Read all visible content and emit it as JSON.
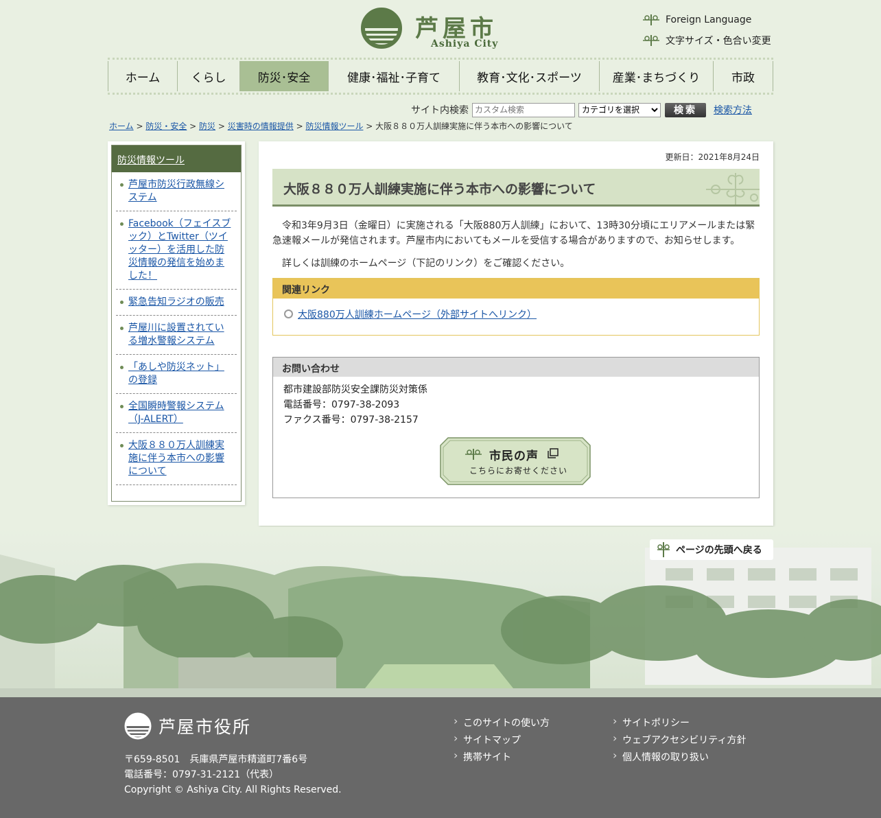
{
  "header": {
    "city_name": "芦屋市",
    "city_name_en": "Ashiya City",
    "util_links": [
      "Foreign Language",
      "文字サイズ・色合い変更"
    ]
  },
  "nav": {
    "items": [
      "ホーム",
      "くらし",
      "防災･安全",
      "健康･福祉･子育て",
      "教育･文化･スポーツ",
      "産業･まちづくり",
      "市政"
    ],
    "active_index": 2
  },
  "search": {
    "label": "サイト内検索",
    "placeholder": "カスタム検索",
    "category_selected": "カテゴリを選択",
    "button": "検索",
    "how_link": "検索方法"
  },
  "breadcrumb": {
    "links": [
      "ホーム",
      "防災・安全",
      "防災",
      "災害時の情報提供",
      "防災情報ツール"
    ],
    "current": "大阪８８０万人訓練実施に伴う本市への影響について",
    "sep": " > "
  },
  "sidebar": {
    "heading": "防災情報ツール",
    "items": [
      "芦屋市防災行政無線システム",
      "Facebook（フェイスブック）とTwitter（ツイッター）を活用した防災情報の発信を始めました！",
      "緊急告知ラジオの販売",
      "芦屋川に設置されている増水警報システム",
      "「あしや防災ネット」の登録",
      "全国瞬時警報システム（J-ALERT）",
      "大阪８８０万人訓練実施に伴う本市への影響について"
    ]
  },
  "main": {
    "updated": "更新日：2021年8月24日",
    "title": "大阪８８０万人訓練実施に伴う本市への影響について",
    "para1": "令和3年9月3日（金曜日）に実施される「大阪880万人訓練」において、13時30分頃にエリアメールまたは緊急速報メールが発信されます。芦屋市内においてもメールを受信する場合がありますので、お知らせします。",
    "para2": "詳しくは訓練のホームページ（下記のリンク）をご確認ください。",
    "related_heading": "関連リンク",
    "related_link": "大阪880万人訓練ホームページ（外部サイトへリンク）",
    "contact_heading": "お問い合わせ",
    "contact_lines": [
      "都市建設部防災安全課防災対策係",
      "電話番号：0797-38-2093",
      "ファクス番号：0797-38-2157"
    ],
    "voice_title": "市民の声",
    "voice_sub": "こちらにお寄せください"
  },
  "pagetop": "ページの先頭へ戻る",
  "footer": {
    "office_name": "芦屋市役所",
    "address": "〒659-8501　兵庫県芦屋市精道町7番6号",
    "tel": "電話番号：0797-31-2121（代表）",
    "copyright": "Copyright © Ashiya City. All Rights Reserved.",
    "links_col1": [
      "このサイトの使い方",
      "サイトマップ",
      "携帯サイト"
    ],
    "links_col2": [
      "サイトポリシー",
      "ウェブアクセシビリティ方針",
      "個人情報の取り扱い"
    ]
  },
  "colors": {
    "page_bg": "#e9f0e2",
    "brand_green": "#5c7a48",
    "nav_active": "#a9bf94",
    "sidebar_head": "#556b41",
    "related_accent": "#e9c459",
    "footer_bg": "#686868"
  }
}
